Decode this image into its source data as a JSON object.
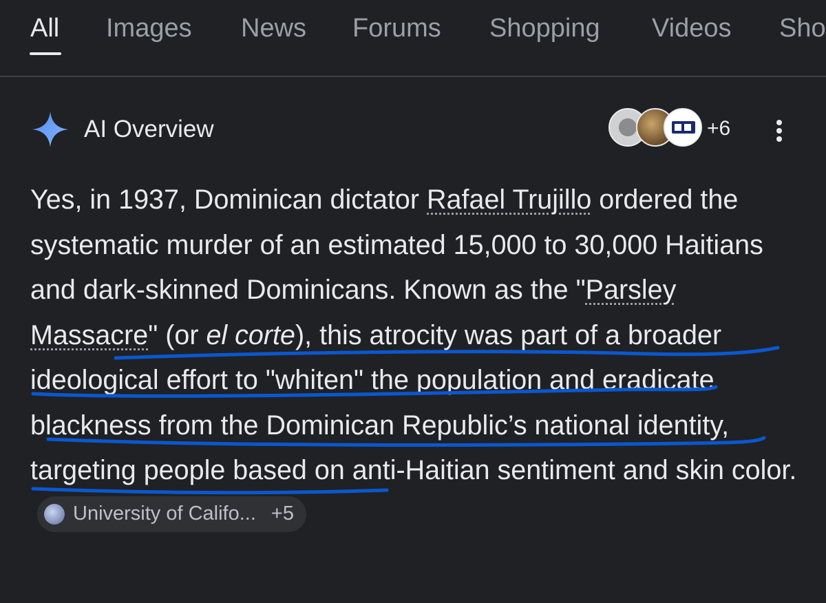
{
  "tabs": [
    {
      "label": "All",
      "active": true
    },
    {
      "label": "Images"
    },
    {
      "label": "News"
    },
    {
      "label": "Forums"
    },
    {
      "label": "Shopping"
    },
    {
      "label": "Videos"
    },
    {
      "label": "Sho"
    }
  ],
  "ai_overview": {
    "title": "AI Overview",
    "sources_more": "+6",
    "avatar_icons": [
      "globe-icon",
      "photo-avatar-icon",
      "pr-logo-icon"
    ]
  },
  "answer": {
    "t1": "Yes, in 1937, Dominican dictator ",
    "link1": "Rafael Trujillo",
    "t2": " ordered the systematic murder of an estimated 15,000 to 30,000 Haitians and dark-skinned Dominicans. Known as the \"",
    "link2": "Parsley Massacre",
    "t3": "\" (or ",
    "em1": "el corte",
    "t4": "), this atrocity was part of a broader ideological effort to \"whiten\" the population and eradicate blackness from the Dominican Republic’s national identity, targeting people based on anti-Haitian sentiment and skin color."
  },
  "source_chip": {
    "label": "University of Califo...",
    "more": "+5"
  },
  "colors": {
    "background": "#202124",
    "text": "#e8eaed",
    "muted": "#9aa0a6",
    "annotation": "#0b57d0"
  }
}
